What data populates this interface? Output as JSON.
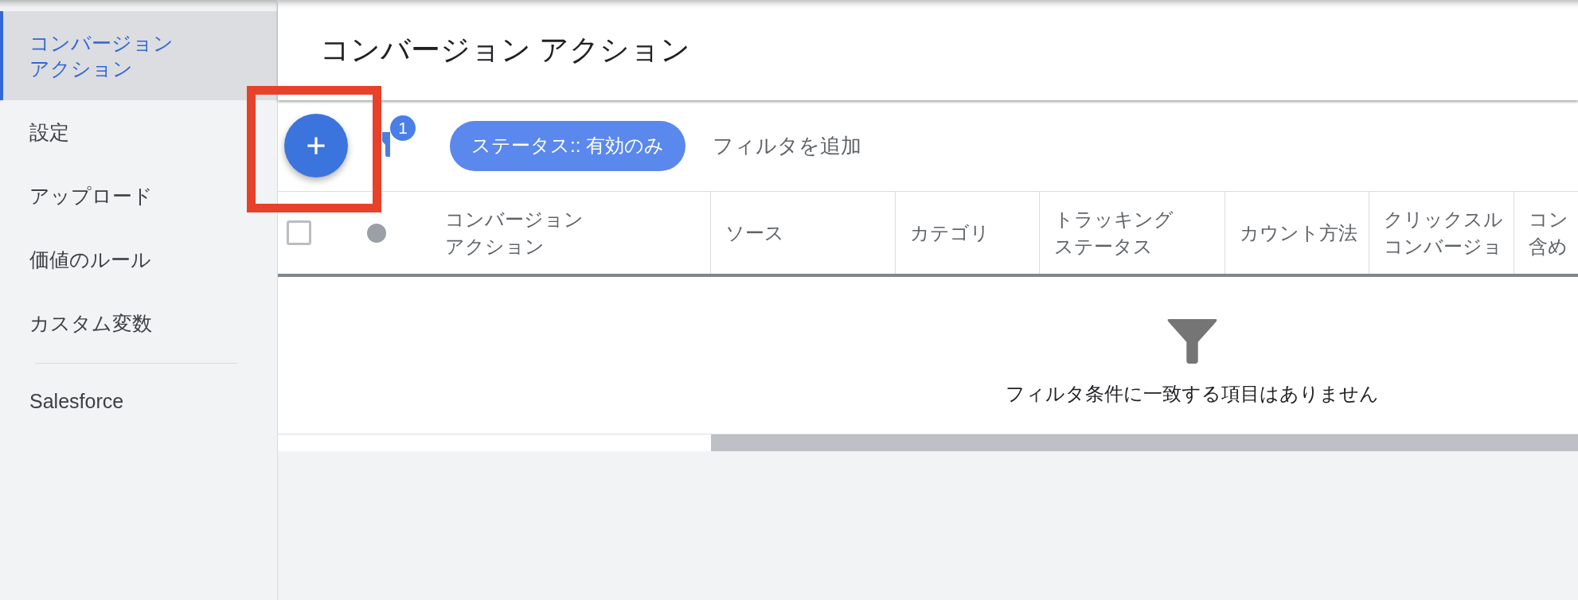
{
  "page_title": "コンバージョン アクション",
  "sidebar": {
    "groups": [
      {
        "items": [
          {
            "lines": [
              "コンバージョン",
              "アクション"
            ],
            "selected": true
          },
          {
            "lines": [
              "設定"
            ],
            "selected": false
          },
          {
            "lines": [
              "アップロード"
            ],
            "selected": false
          },
          {
            "lines": [
              "価値のルール"
            ],
            "selected": false
          },
          {
            "lines": [
              "カスタム変数"
            ],
            "selected": false
          }
        ]
      },
      {
        "items": [
          {
            "lines": [
              "Salesforce"
            ],
            "selected": false
          }
        ]
      }
    ]
  },
  "toolbar": {
    "add_button": {
      "highlighted": true
    },
    "filter_button": {
      "badge": "1"
    },
    "filter_chips": [
      {
        "label": "ステータス:: 有効のみ"
      }
    ],
    "add_filter": {
      "label": "フィルタを追加"
    }
  },
  "table": {
    "select_all": {
      "checked": false
    },
    "columns": [
      {
        "lines": [
          "コンバージョン",
          "アクション"
        ]
      },
      {
        "lines": [
          "ソース"
        ]
      },
      {
        "lines": [
          "カテゴリ"
        ]
      },
      {
        "lines": [
          "トラッキング",
          "ステータス"
        ]
      },
      {
        "lines": [
          "カウント方法"
        ]
      },
      {
        "lines": [
          "クリックスル",
          "コンバージョ"
        ]
      },
      {
        "lines": [
          "コン",
          "含め"
        ]
      }
    ],
    "empty_message": "フィルタ条件に一致する項目はありません"
  }
}
